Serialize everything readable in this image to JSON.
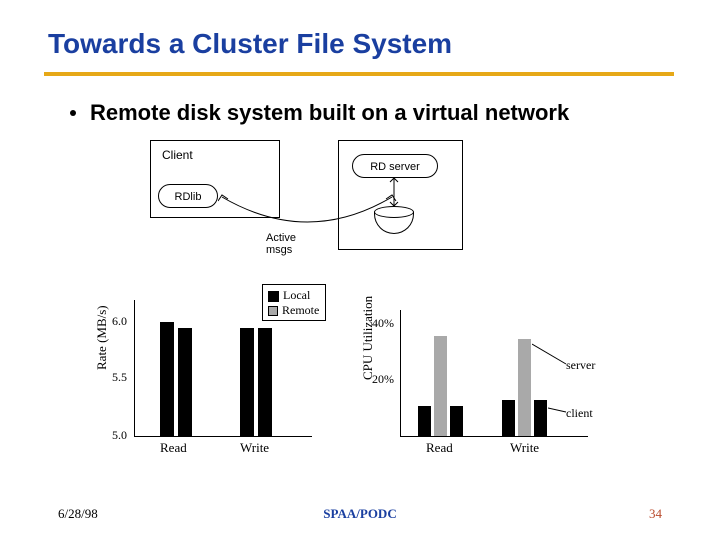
{
  "title": "Towards a Cluster File System",
  "bullet": "Remote disk system built on a virtual network",
  "diagram": {
    "client": "Client",
    "rdlib": "RDlib",
    "rdserver": "RD server",
    "active_msgs_l1": "Active",
    "active_msgs_l2": "msgs"
  },
  "legend": {
    "local": "Local",
    "remote": "Remote"
  },
  "mini_labels": {
    "server": "server",
    "client": "client"
  },
  "footer": {
    "date": "6/28/98",
    "center": "SPAA/PODC",
    "page": "34"
  },
  "chart_data": [
    {
      "type": "bar",
      "title": "",
      "xlabel": "",
      "ylabel": "Rate (MB/s)",
      "ylim": [
        5.0,
        6.2
      ],
      "yticks": [
        "6.0",
        "5.5",
        "5.0"
      ],
      "categories": [
        "Read",
        "Write"
      ],
      "series": [
        {
          "name": "Local",
          "values": [
            5.95,
            5.9
          ]
        },
        {
          "name": "Remote",
          "values": [
            5.9,
            5.9
          ]
        }
      ]
    },
    {
      "type": "bar",
      "title": "",
      "xlabel": "",
      "ylabel": "CPU Utilization",
      "ylim": [
        0,
        45
      ],
      "yticks": [
        "40%",
        "20%"
      ],
      "categories": [
        "Read",
        "Write"
      ],
      "series": [
        {
          "name": "Local",
          "values": [
            11,
            13
          ]
        },
        {
          "name": "Remote (server)",
          "values": [
            36,
            35
          ]
        },
        {
          "name": "Remote (client)",
          "values": [
            11,
            13
          ]
        }
      ]
    }
  ]
}
